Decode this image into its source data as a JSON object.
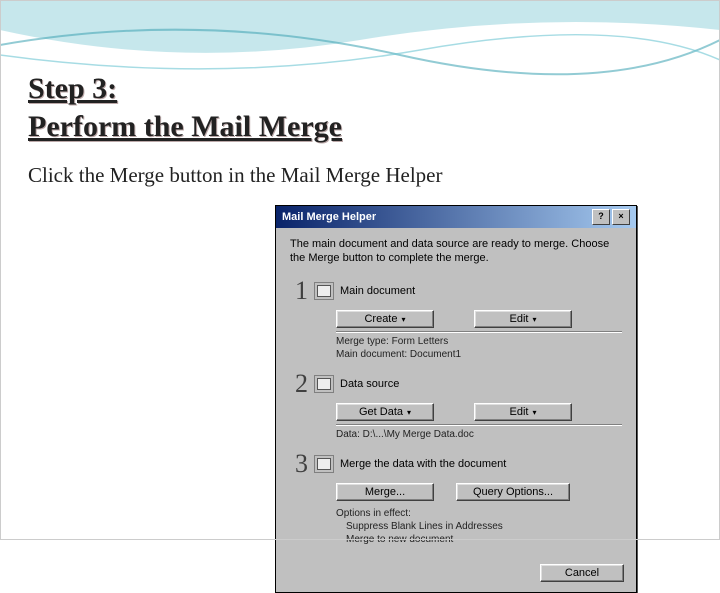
{
  "slide": {
    "title_line1": "Step 3:",
    "title_line2": "Perform the Mail Merge",
    "instruction": "Click the Merge button in the Mail Merge Helper"
  },
  "dialog": {
    "title": "Mail Merge Helper",
    "help_btn": "?",
    "close_btn": "×",
    "message": "The main document and data source are ready to merge. Choose the Merge button to complete the merge.",
    "sections": [
      {
        "num": "1",
        "label": "Main document",
        "buttons": [
          "Create",
          "Edit"
        ],
        "info_lines": [
          "Merge type: Form Letters",
          "Main document: Document1"
        ]
      },
      {
        "num": "2",
        "label": "Data source",
        "buttons": [
          "Get Data",
          "Edit"
        ],
        "info_lines": [
          "Data: D:\\...\\My Merge Data.doc"
        ]
      },
      {
        "num": "3",
        "label": "Merge the data with the document",
        "buttons": [
          "Merge...",
          "Query Options..."
        ],
        "options_heading": "Options in effect:",
        "options_lines": [
          "Suppress Blank Lines in Addresses",
          "Merge to new document"
        ]
      }
    ],
    "cancel": "Cancel"
  }
}
